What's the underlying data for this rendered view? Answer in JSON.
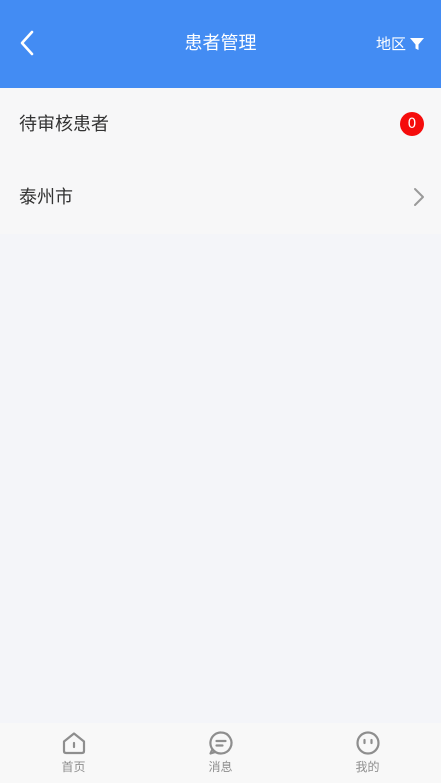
{
  "header": {
    "title": "患者管理",
    "region_label": "地区",
    "background_color": "#438cf3",
    "back_icon": "chevron-left-icon",
    "filter_icon": "filter-funnel-icon"
  },
  "list": {
    "items": [
      {
        "label": "待审核患者",
        "badge": "0",
        "badge_color": "#f50c0c"
      },
      {
        "label": "泰州市",
        "trailing_icon": "chevron-right-icon"
      }
    ]
  },
  "tabbar": {
    "items": [
      {
        "label": "首页",
        "icon": "home-icon"
      },
      {
        "label": "消息",
        "icon": "message-icon"
      },
      {
        "label": "我的",
        "icon": "profile-face-icon"
      }
    ]
  }
}
